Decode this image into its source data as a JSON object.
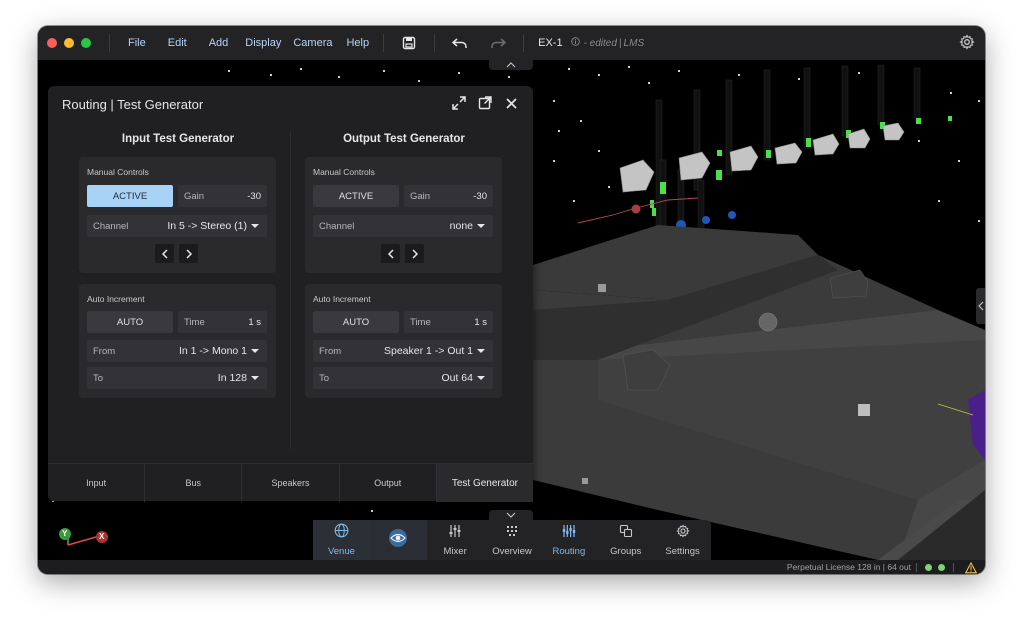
{
  "menu": {
    "items": [
      "File",
      "Edit",
      "Add",
      "Display",
      "Camera",
      "Help"
    ]
  },
  "document": {
    "name": "EX-1",
    "info_icon": "info-icon",
    "status": "- edited",
    "separator": "|",
    "mode": "LMS"
  },
  "panel": {
    "title": "Routing | Test Generator",
    "input": {
      "heading": "Input Test Generator",
      "manual": {
        "label": "Manual Controls",
        "active_label": "ACTIVE",
        "gain_label": "Gain",
        "gain_value": "-30",
        "channel_label": "Channel",
        "channel_value": "In 5 -> Stereo (1)"
      },
      "auto": {
        "label": "Auto Increment",
        "auto_label": "AUTO",
        "time_label": "Time",
        "time_value": "1 s",
        "from_label": "From",
        "from_value": "In 1 -> Mono 1",
        "to_label": "To",
        "to_value": "In 128"
      }
    },
    "output": {
      "heading": "Output Test Generator",
      "manual": {
        "label": "Manual Controls",
        "active_label": "ACTIVE",
        "gain_label": "Gain",
        "gain_value": "-30",
        "channel_label": "Channel",
        "channel_value": "none"
      },
      "auto": {
        "label": "Auto Increment",
        "auto_label": "AUTO",
        "time_label": "Time",
        "time_value": "1 s",
        "from_label": "From",
        "from_value": "Speaker 1 -> Out 1",
        "to_label": "To",
        "to_value": "Out 64"
      }
    },
    "tabs": [
      "Input",
      "Bus",
      "Speakers",
      "Output",
      "Test Generator"
    ],
    "active_tab": "Test Generator"
  },
  "dock": {
    "items": [
      {
        "label": "Venue",
        "icon": "globe-icon"
      },
      {
        "label": "",
        "icon": "eye-icon"
      },
      {
        "label": "Mixer",
        "icon": "mixer-icon"
      },
      {
        "label": "Overview",
        "icon": "overview-icon"
      },
      {
        "label": "Routing",
        "icon": "routing-icon"
      },
      {
        "label": "Groups",
        "icon": "groups-icon"
      },
      {
        "label": "Settings",
        "icon": "gear-icon"
      }
    ]
  },
  "axes": {
    "y": "Y",
    "x": "X"
  },
  "status": {
    "license": "Perpetual License 128 in | 64 out"
  },
  "colors": {
    "accent_blue": "#a9d2f7",
    "active_tab_text": "#7fbbf0",
    "meter_green": "#4be04a",
    "status_green": "#7fd07a",
    "warning_yellow": "#f5c542"
  }
}
